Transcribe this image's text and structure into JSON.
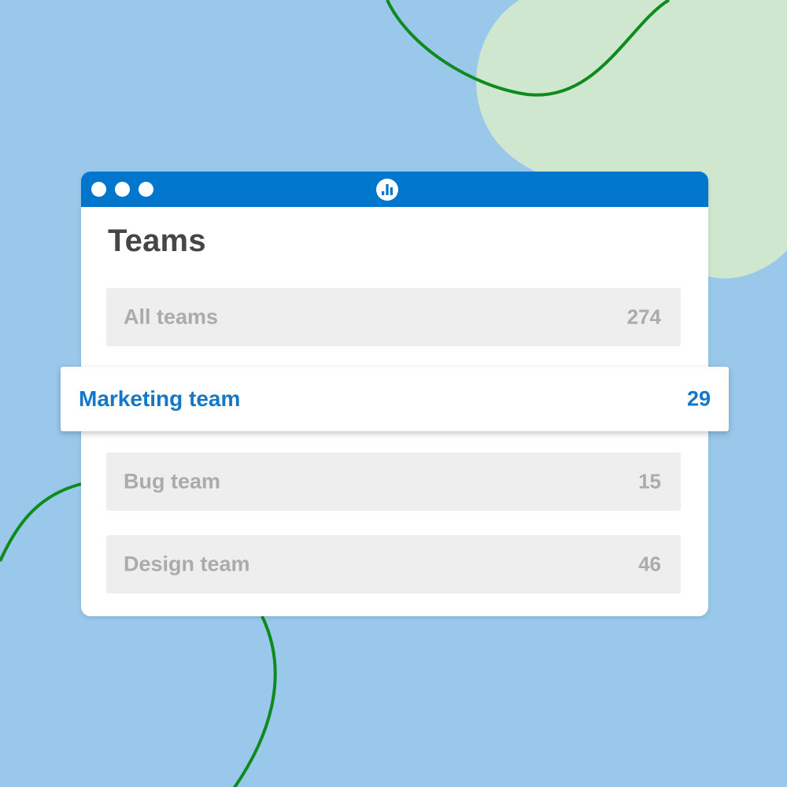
{
  "colors": {
    "background": "#99c8ea",
    "blob": "#cfe7cf",
    "curve": "#0f8a1e",
    "titlebar": "#0077cc",
    "accent": "#1577c6",
    "row_background": "#eeeeee",
    "row_text": "#ababab",
    "title_text": "#464646"
  },
  "window": {
    "controls": [
      "window-dot",
      "window-dot",
      "window-dot"
    ],
    "logo_icon": "bar-chart-icon"
  },
  "page": {
    "title": "Teams"
  },
  "teams": {
    "all": {
      "label": "All teams",
      "count": "274"
    },
    "selected": {
      "label": "Marketing team",
      "count": "29"
    },
    "bug": {
      "label": "Bug team",
      "count": "15"
    },
    "design": {
      "label": "Design team",
      "count": "46"
    }
  }
}
